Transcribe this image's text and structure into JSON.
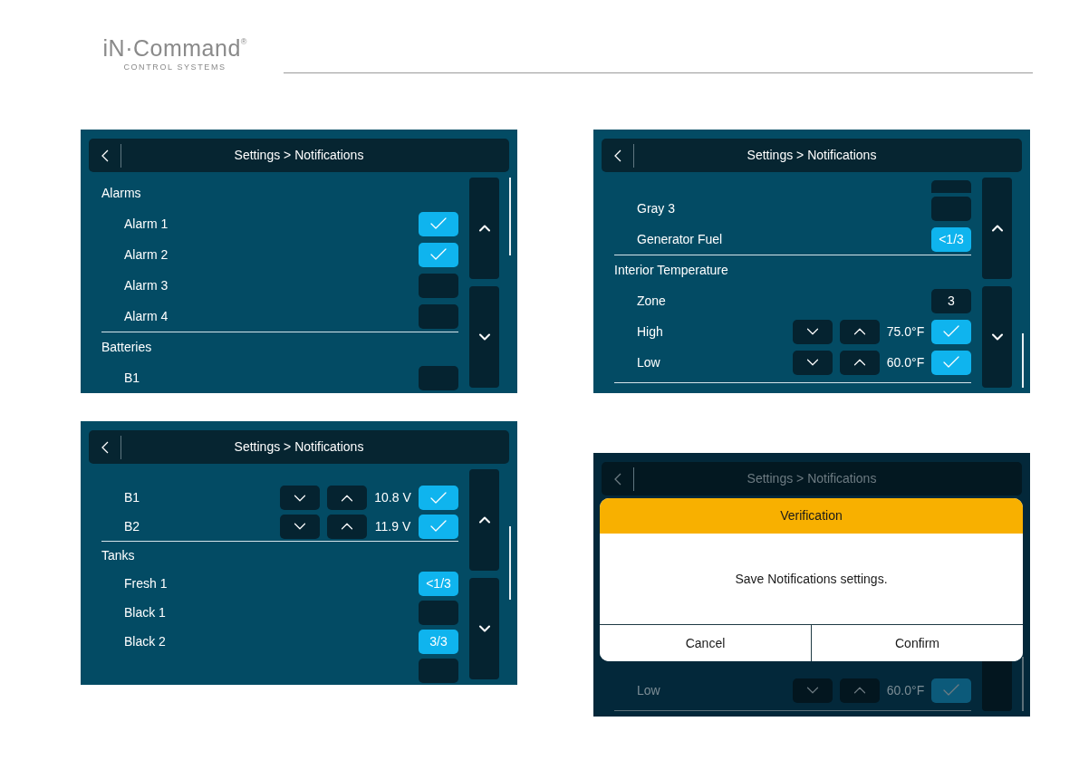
{
  "logo": {
    "name": "iN·Command",
    "mark": "®",
    "tagline": "CONTROL SYSTEMS"
  },
  "screens": [
    {
      "title": "Settings > Notifications",
      "dimmed": false,
      "rows": [
        {
          "kind": "section",
          "label": "Alarms",
          "divider": false
        },
        {
          "kind": "toggle",
          "label": "Alarm 1",
          "checked": true
        },
        {
          "kind": "toggle",
          "label": "Alarm 2",
          "checked": true
        },
        {
          "kind": "toggle",
          "label": "Alarm 3",
          "checked": false
        },
        {
          "kind": "toggle",
          "label": "Alarm 4",
          "checked": false
        },
        {
          "kind": "section",
          "label": "Batteries",
          "divider": true
        },
        {
          "kind": "toggle",
          "label": "B1",
          "checked": false
        }
      ]
    },
    {
      "title": "Settings > Notifications",
      "dimmed": false,
      "rows": [
        {
          "kind": "clipped_top"
        },
        {
          "kind": "threshold",
          "label": "B1",
          "reading": "10.8 V",
          "checked": true
        },
        {
          "kind": "threshold",
          "label": "B2",
          "reading": "11.9 V",
          "checked": true
        },
        {
          "kind": "section",
          "label": "Tanks",
          "divider": true
        },
        {
          "kind": "value",
          "label": "Fresh 1",
          "value": "<1/3",
          "on": true
        },
        {
          "kind": "toggle",
          "label": "Black 1",
          "checked": false
        },
        {
          "kind": "value",
          "label": "Black 2",
          "value": "3/3",
          "on": true
        },
        {
          "kind": "clipped_bottom",
          "box": true
        }
      ]
    },
    {
      "title": "Settings > Notifications",
      "dimmed": false,
      "rows": [
        {
          "kind": "clipped_top",
          "box": true
        },
        {
          "kind": "toggle",
          "label": "Gray 3",
          "checked": false
        },
        {
          "kind": "value",
          "label": "Generator Fuel",
          "value": "<1/3",
          "on": true
        },
        {
          "kind": "section",
          "label": "Interior Temperature",
          "divider": true
        },
        {
          "kind": "value",
          "label": "Zone",
          "value": "3",
          "on": false
        },
        {
          "kind": "threshold",
          "label": "High",
          "reading": "75.0°F",
          "checked": true
        },
        {
          "kind": "threshold",
          "label": "Low",
          "reading": "60.0°F",
          "checked": true
        },
        {
          "kind": "rule"
        }
      ]
    },
    {
      "title": "Settings > Notifications",
      "dimmed": true,
      "rows": [
        {
          "kind": "threshold",
          "label": "Low",
          "reading": "60.0°F",
          "checked": true
        },
        {
          "kind": "rule"
        }
      ],
      "dialog": {
        "title": "Verification",
        "message": "Save Notifications settings.",
        "buttons": [
          "Cancel",
          "Confirm"
        ]
      }
    }
  ]
}
